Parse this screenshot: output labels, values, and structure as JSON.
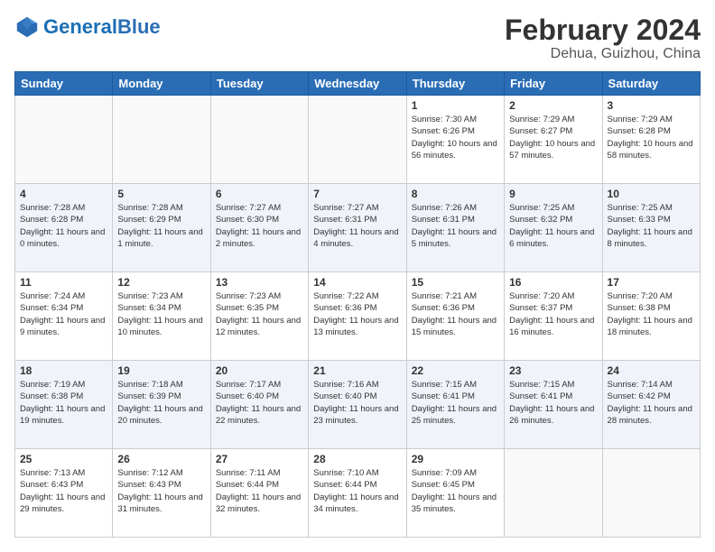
{
  "header": {
    "logo_general": "General",
    "logo_blue": "Blue",
    "month_year": "February 2024",
    "location": "Dehua, Guizhou, China"
  },
  "days_of_week": [
    "Sunday",
    "Monday",
    "Tuesday",
    "Wednesday",
    "Thursday",
    "Friday",
    "Saturday"
  ],
  "weeks": [
    [
      {
        "day": "",
        "sunrise": "",
        "sunset": "",
        "daylight": "",
        "empty": true
      },
      {
        "day": "",
        "sunrise": "",
        "sunset": "",
        "daylight": "",
        "empty": true
      },
      {
        "day": "",
        "sunrise": "",
        "sunset": "",
        "daylight": "",
        "empty": true
      },
      {
        "day": "",
        "sunrise": "",
        "sunset": "",
        "daylight": "",
        "empty": true
      },
      {
        "day": "1",
        "sunrise": "Sunrise: 7:30 AM",
        "sunset": "Sunset: 6:26 PM",
        "daylight": "Daylight: 10 hours and 56 minutes."
      },
      {
        "day": "2",
        "sunrise": "Sunrise: 7:29 AM",
        "sunset": "Sunset: 6:27 PM",
        "daylight": "Daylight: 10 hours and 57 minutes."
      },
      {
        "day": "3",
        "sunrise": "Sunrise: 7:29 AM",
        "sunset": "Sunset: 6:28 PM",
        "daylight": "Daylight: 10 hours and 58 minutes."
      }
    ],
    [
      {
        "day": "4",
        "sunrise": "Sunrise: 7:28 AM",
        "sunset": "Sunset: 6:28 PM",
        "daylight": "Daylight: 11 hours and 0 minutes."
      },
      {
        "day": "5",
        "sunrise": "Sunrise: 7:28 AM",
        "sunset": "Sunset: 6:29 PM",
        "daylight": "Daylight: 11 hours and 1 minute."
      },
      {
        "day": "6",
        "sunrise": "Sunrise: 7:27 AM",
        "sunset": "Sunset: 6:30 PM",
        "daylight": "Daylight: 11 hours and 2 minutes."
      },
      {
        "day": "7",
        "sunrise": "Sunrise: 7:27 AM",
        "sunset": "Sunset: 6:31 PM",
        "daylight": "Daylight: 11 hours and 4 minutes."
      },
      {
        "day": "8",
        "sunrise": "Sunrise: 7:26 AM",
        "sunset": "Sunset: 6:31 PM",
        "daylight": "Daylight: 11 hours and 5 minutes."
      },
      {
        "day": "9",
        "sunrise": "Sunrise: 7:25 AM",
        "sunset": "Sunset: 6:32 PM",
        "daylight": "Daylight: 11 hours and 6 minutes."
      },
      {
        "day": "10",
        "sunrise": "Sunrise: 7:25 AM",
        "sunset": "Sunset: 6:33 PM",
        "daylight": "Daylight: 11 hours and 8 minutes."
      }
    ],
    [
      {
        "day": "11",
        "sunrise": "Sunrise: 7:24 AM",
        "sunset": "Sunset: 6:34 PM",
        "daylight": "Daylight: 11 hours and 9 minutes."
      },
      {
        "day": "12",
        "sunrise": "Sunrise: 7:23 AM",
        "sunset": "Sunset: 6:34 PM",
        "daylight": "Daylight: 11 hours and 10 minutes."
      },
      {
        "day": "13",
        "sunrise": "Sunrise: 7:23 AM",
        "sunset": "Sunset: 6:35 PM",
        "daylight": "Daylight: 11 hours and 12 minutes."
      },
      {
        "day": "14",
        "sunrise": "Sunrise: 7:22 AM",
        "sunset": "Sunset: 6:36 PM",
        "daylight": "Daylight: 11 hours and 13 minutes."
      },
      {
        "day": "15",
        "sunrise": "Sunrise: 7:21 AM",
        "sunset": "Sunset: 6:36 PM",
        "daylight": "Daylight: 11 hours and 15 minutes."
      },
      {
        "day": "16",
        "sunrise": "Sunrise: 7:20 AM",
        "sunset": "Sunset: 6:37 PM",
        "daylight": "Daylight: 11 hours and 16 minutes."
      },
      {
        "day": "17",
        "sunrise": "Sunrise: 7:20 AM",
        "sunset": "Sunset: 6:38 PM",
        "daylight": "Daylight: 11 hours and 18 minutes."
      }
    ],
    [
      {
        "day": "18",
        "sunrise": "Sunrise: 7:19 AM",
        "sunset": "Sunset: 6:38 PM",
        "daylight": "Daylight: 11 hours and 19 minutes."
      },
      {
        "day": "19",
        "sunrise": "Sunrise: 7:18 AM",
        "sunset": "Sunset: 6:39 PM",
        "daylight": "Daylight: 11 hours and 20 minutes."
      },
      {
        "day": "20",
        "sunrise": "Sunrise: 7:17 AM",
        "sunset": "Sunset: 6:40 PM",
        "daylight": "Daylight: 11 hours and 22 minutes."
      },
      {
        "day": "21",
        "sunrise": "Sunrise: 7:16 AM",
        "sunset": "Sunset: 6:40 PM",
        "daylight": "Daylight: 11 hours and 23 minutes."
      },
      {
        "day": "22",
        "sunrise": "Sunrise: 7:15 AM",
        "sunset": "Sunset: 6:41 PM",
        "daylight": "Daylight: 11 hours and 25 minutes."
      },
      {
        "day": "23",
        "sunrise": "Sunrise: 7:15 AM",
        "sunset": "Sunset: 6:41 PM",
        "daylight": "Daylight: 11 hours and 26 minutes."
      },
      {
        "day": "24",
        "sunrise": "Sunrise: 7:14 AM",
        "sunset": "Sunset: 6:42 PM",
        "daylight": "Daylight: 11 hours and 28 minutes."
      }
    ],
    [
      {
        "day": "25",
        "sunrise": "Sunrise: 7:13 AM",
        "sunset": "Sunset: 6:43 PM",
        "daylight": "Daylight: 11 hours and 29 minutes."
      },
      {
        "day": "26",
        "sunrise": "Sunrise: 7:12 AM",
        "sunset": "Sunset: 6:43 PM",
        "daylight": "Daylight: 11 hours and 31 minutes."
      },
      {
        "day": "27",
        "sunrise": "Sunrise: 7:11 AM",
        "sunset": "Sunset: 6:44 PM",
        "daylight": "Daylight: 11 hours and 32 minutes."
      },
      {
        "day": "28",
        "sunrise": "Sunrise: 7:10 AM",
        "sunset": "Sunset: 6:44 PM",
        "daylight": "Daylight: 11 hours and 34 minutes."
      },
      {
        "day": "29",
        "sunrise": "Sunrise: 7:09 AM",
        "sunset": "Sunset: 6:45 PM",
        "daylight": "Daylight: 11 hours and 35 minutes."
      },
      {
        "day": "",
        "sunrise": "",
        "sunset": "",
        "daylight": "",
        "empty": true
      },
      {
        "day": "",
        "sunrise": "",
        "sunset": "",
        "daylight": "",
        "empty": true
      }
    ]
  ]
}
